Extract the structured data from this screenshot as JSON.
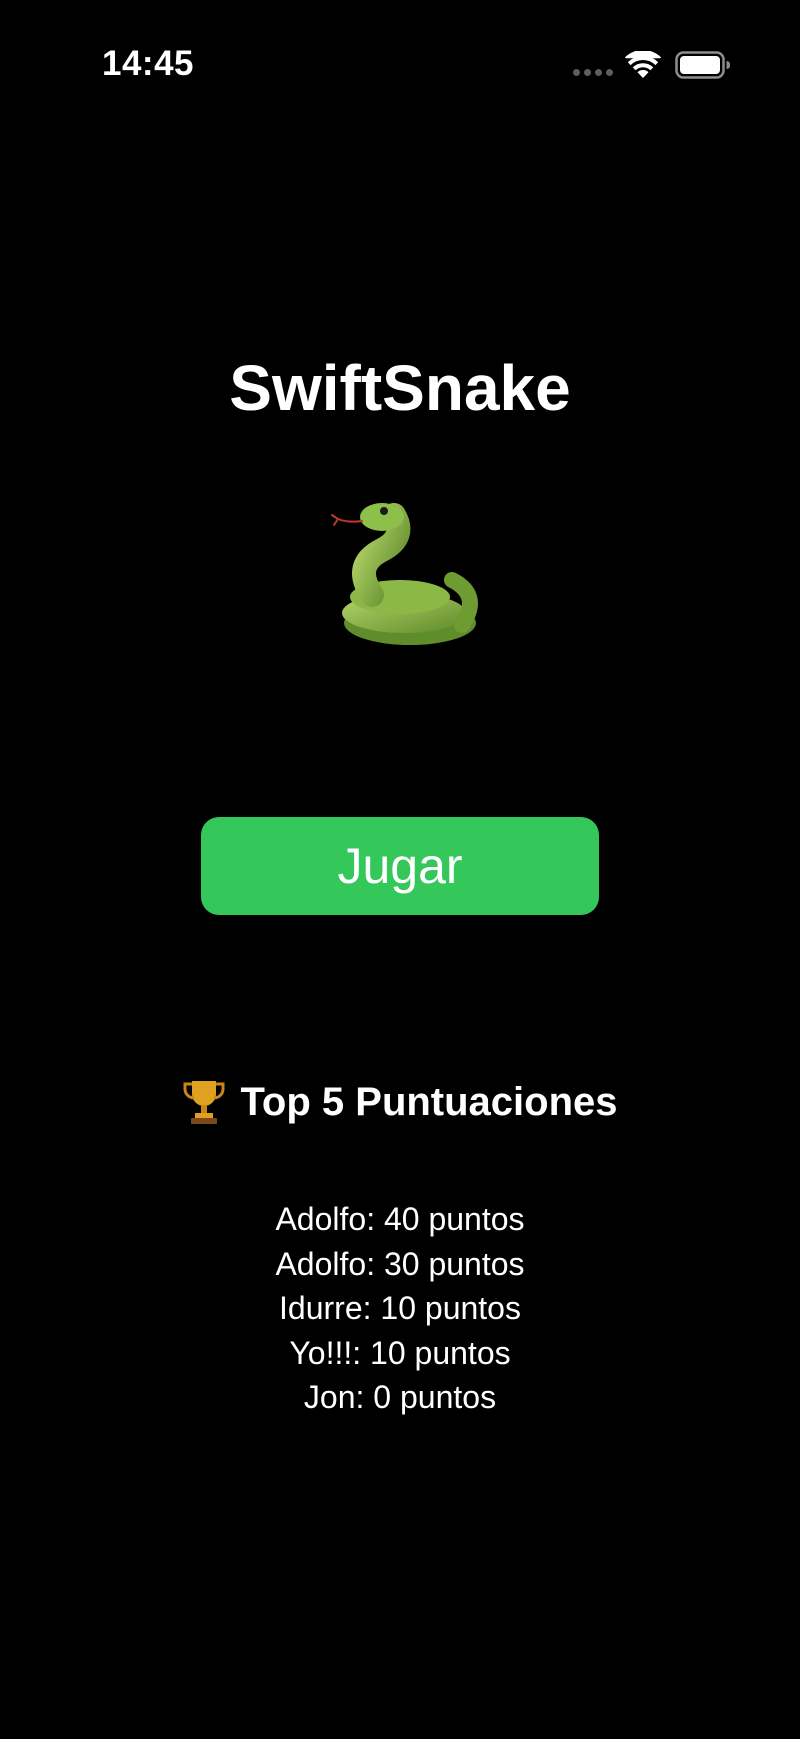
{
  "status_bar": {
    "time": "14:45"
  },
  "app": {
    "title": "SwiftSnake",
    "snake_icon": "snake-emoji",
    "play_button_label": "Jugar"
  },
  "scores": {
    "heading_icon": "trophy-emoji",
    "heading": "Top 5 Puntuaciones",
    "entries": [
      "Adolfo: 40 puntos",
      "Adolfo: 30 puntos",
      "Idurre: 10 puntos",
      "Yo!!!: 10 puntos",
      "Jon: 0 puntos"
    ]
  },
  "colors": {
    "background": "#000000",
    "play_button": "#34c759",
    "text": "#ffffff"
  }
}
